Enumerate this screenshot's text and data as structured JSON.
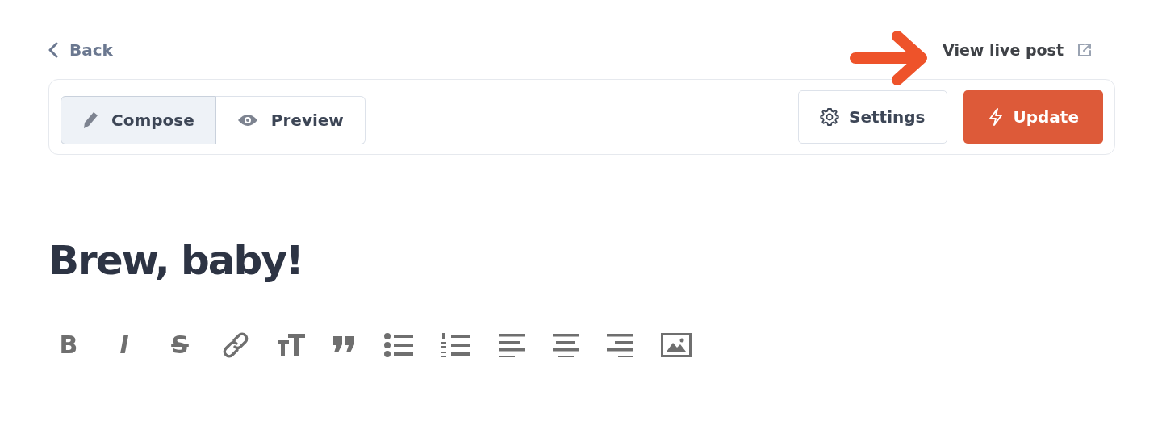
{
  "back_link": {
    "label": "Back"
  },
  "view_live_link": {
    "label": "View live post"
  },
  "tabs": [
    {
      "label": "Compose",
      "kind": "pencil",
      "selected": true
    },
    {
      "label": "Preview",
      "kind": "eye",
      "selected": false
    }
  ],
  "actions": [
    {
      "label": "Settings",
      "kind": "secondary"
    },
    {
      "label": "Update",
      "kind": "primary"
    }
  ],
  "post_title": "Brew, baby!",
  "format_toolbar": [
    {
      "kind": "bold",
      "glyph": "B"
    },
    {
      "kind": "italic",
      "glyph": "I"
    },
    {
      "kind": "strike",
      "glyph": "S"
    },
    {
      "kind": "link"
    },
    {
      "kind": "text-size"
    },
    {
      "kind": "quote"
    },
    {
      "kind": "bullet-list"
    },
    {
      "kind": "numbered-list"
    },
    {
      "kind": "align-left"
    },
    {
      "kind": "align-center"
    },
    {
      "kind": "align-right"
    },
    {
      "kind": "image"
    }
  ]
}
